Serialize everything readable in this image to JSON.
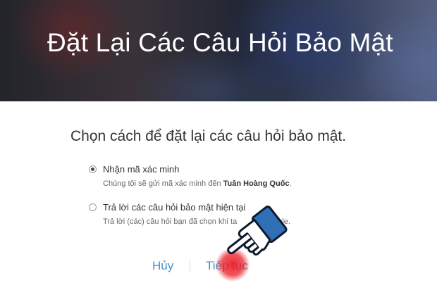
{
  "header": {
    "title": "Đặt Lại Các Câu Hỏi Bảo Mật"
  },
  "main": {
    "prompt": "Chọn cách để đặt lại các câu hỏi bảo mật.",
    "options": [
      {
        "label": "Nhận mã xác minh",
        "description_prefix": "Chúng tôi sẽ gửi mã xác minh đến ",
        "description_name": "Tuân Hoàng Quốc",
        "description_suffix": ".",
        "checked": true
      },
      {
        "label": "Trả lời các câu hỏi bảo mật hiện tại",
        "description_start": "Trả lời (các) câu hỏi bạn đã chọn khi ta",
        "description_end": "ple.",
        "checked": false
      }
    ]
  },
  "actions": {
    "cancel_label": "Hủy",
    "continue_label": "Tiếp tục"
  },
  "colors": {
    "link": "#4a90c8",
    "tap_highlight": "#eb1e28",
    "hand_cuff": "#2f6fb8"
  },
  "icons": {
    "pointer": "pointing-hand-icon"
  }
}
